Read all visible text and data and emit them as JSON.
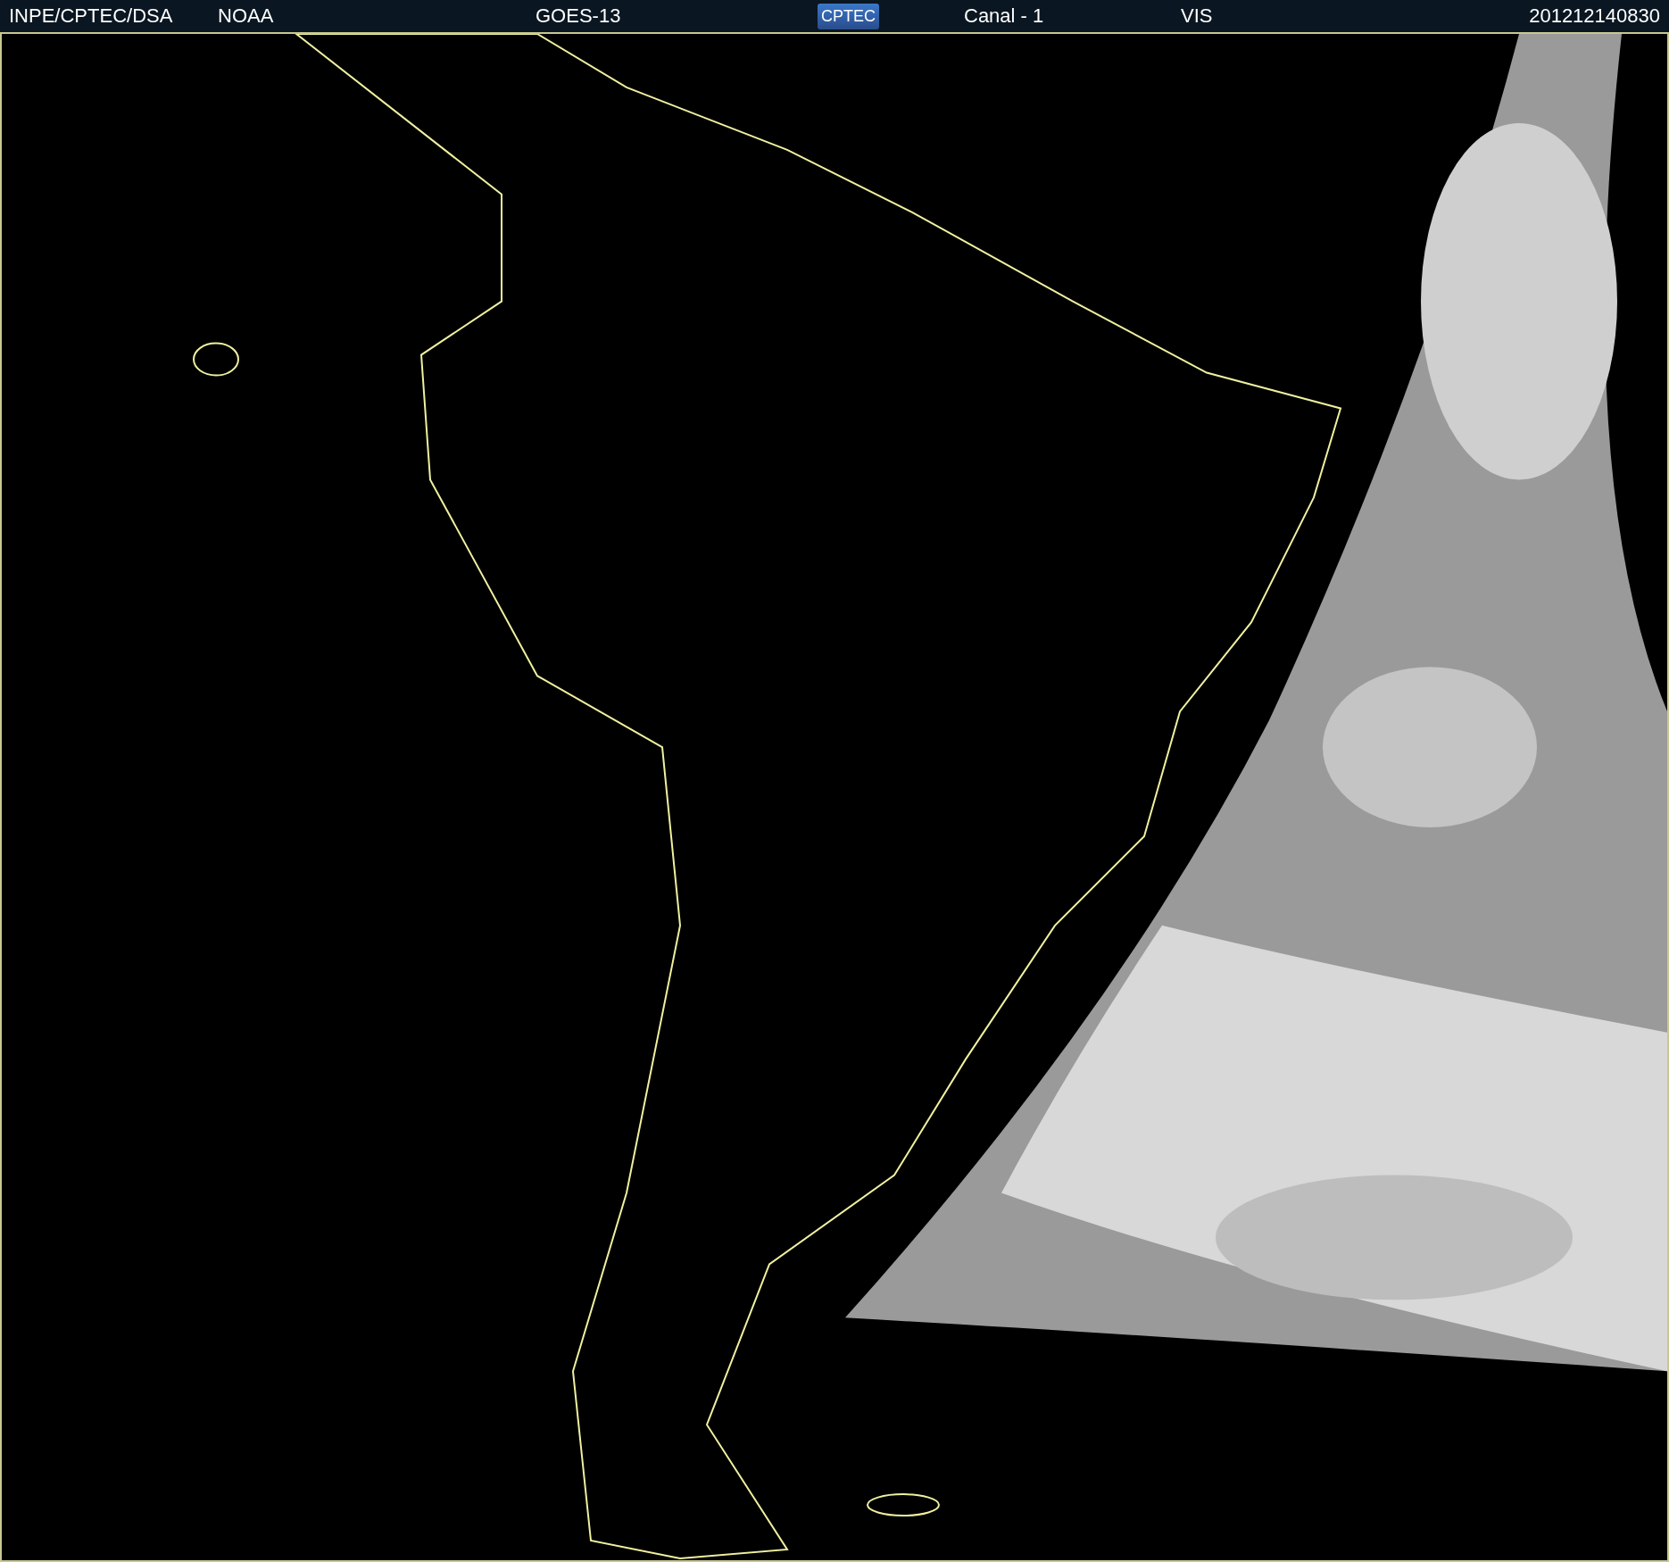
{
  "header": {
    "items": [
      {
        "kind": "text",
        "text": "INPE/CPTEC/DSA"
      },
      {
        "kind": "text",
        "text": "NOAA"
      },
      {
        "kind": "text",
        "text": "GOES-13"
      },
      {
        "kind": "logo",
        "text": "CPTEC"
      },
      {
        "kind": "text",
        "text": "Canal - 1"
      },
      {
        "kind": "text",
        "text": "VIS"
      },
      {
        "kind": "time",
        "text": "201212140830"
      }
    ]
  }
}
